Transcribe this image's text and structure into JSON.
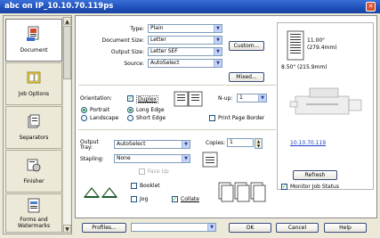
{
  "window": {
    "title": "abc on IP_10.10.70.119ps",
    "close_glyph": "✕"
  },
  "sidebar": {
    "items": [
      {
        "label": "Document",
        "icon": "document-icon"
      },
      {
        "label": "Job Options",
        "icon": "job-options-icon"
      },
      {
        "label": "Separators",
        "icon": "separators-icon"
      },
      {
        "label": "Finisher",
        "icon": "finisher-icon"
      },
      {
        "label": "Forms and Watermarks",
        "icon": "forms-watermarks-icon"
      }
    ],
    "scroll_up": "▲",
    "scroll_down": "▼"
  },
  "paper": {
    "type_label": "Type:",
    "type_value": "Plain",
    "size_label": "Document Size:",
    "size_value": "Letter",
    "output_size_label": "Output Size:",
    "output_size_value": "Letter SEF",
    "source_label": "Source:",
    "source_value": "AutoSelect",
    "custom_button": "Custom...",
    "mixed_button": "Mixed..."
  },
  "orientation": {
    "label": "Orientation:",
    "duplex_label": "Duplex",
    "portrait_label": "Portrait",
    "landscape_label": "Landscape",
    "long_edge_label": "Long Edge",
    "short_edge_label": "Short Edge",
    "nup_label": "N-up:",
    "nup_value": "1",
    "print_page_border_label": "Print Page Border"
  },
  "output": {
    "tray_label": "Output Tray:",
    "tray_value": "AutoSelect",
    "stapling_label": "Stapling:",
    "stapling_value": "None",
    "copies_label": "Copies:",
    "copies_value": "1",
    "face_up_label": "Face Up",
    "booklet_label": "Booklet",
    "jog_label": "Jog",
    "collate_label": "Collate"
  },
  "preview": {
    "height_text": "11.00\"",
    "height_mm_text": "(279.4mm)",
    "width_text": "8.50\" (215.9mm)",
    "printer_address": "10.10.70.119",
    "refresh_button": "Refresh",
    "monitor_label": "Monitor Job Status"
  },
  "footer": {
    "profiles_button": "Profiles...",
    "ok_button": "OK",
    "cancel_button": "Cancel",
    "help_button": "Help"
  },
  "colors": {
    "accent": "#21a121",
    "titlebar": "#1f4fb8",
    "link": "#1c3fbf"
  }
}
